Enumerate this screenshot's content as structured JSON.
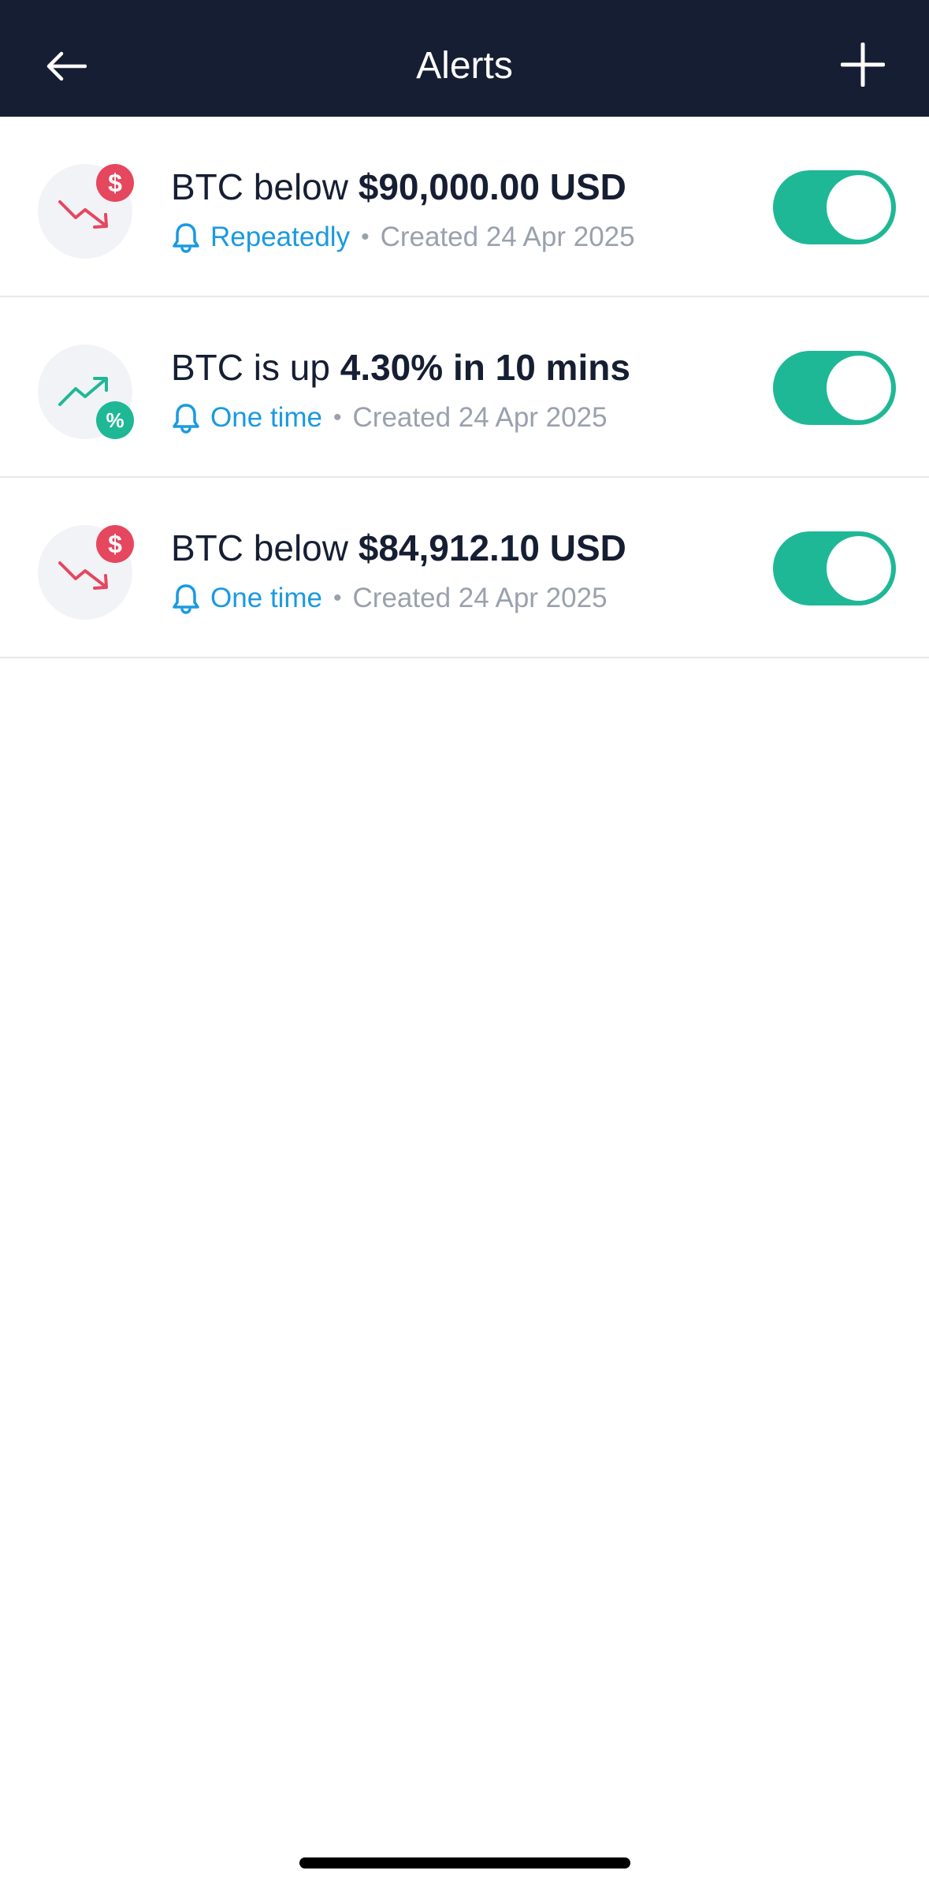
{
  "header": {
    "title": "Alerts",
    "back_icon": "arrow-left-icon",
    "add_icon": "plus-icon",
    "background": "#161e33"
  },
  "alerts": [
    {
      "prefix": "BTC below ",
      "value": "$90,000.00 USD",
      "frequency": "Repeatedly",
      "separator": "•",
      "created": "Created 24 Apr 2025",
      "icon": "price-down-icon",
      "badge": "$",
      "enabled": true
    },
    {
      "prefix": "BTC is up ",
      "value": "4.30% in 10 mins",
      "frequency": "One time",
      "separator": "•",
      "created": "Created 24 Apr 2025",
      "icon": "percent-up-icon",
      "badge": "%",
      "enabled": true
    },
    {
      "prefix": "BTC below ",
      "value": "$84,912.10 USD",
      "frequency": "One time",
      "separator": "•",
      "created": "Created 24 Apr 2025",
      "icon": "price-down-icon",
      "badge": "$",
      "enabled": true
    }
  ],
  "colors": {
    "accent_green": "#1fb896",
    "alert_red": "#e5475f",
    "link_blue": "#1a9ae0",
    "muted_gray": "#9aa1ad"
  }
}
